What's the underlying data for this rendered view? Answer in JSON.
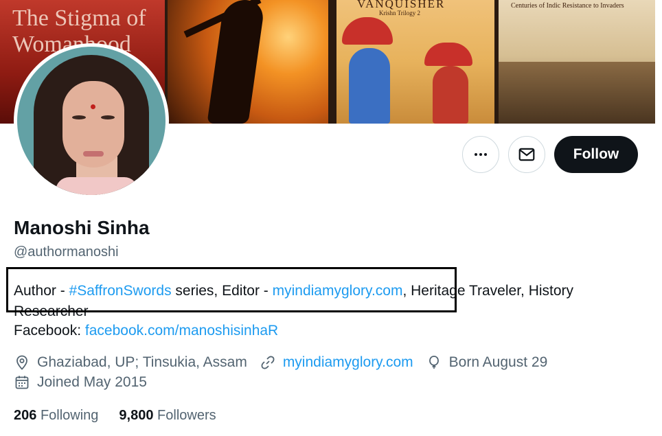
{
  "banner": {
    "book1_title": "The Stigma of Womanhood",
    "book3_title": "VANQUISHER",
    "book3_subtitle": "Krishn Trilogy 2",
    "book4_subtitle": "Centuries of Indic Resistance to Invaders"
  },
  "actions": {
    "more_icon": "more-horizontal-icon",
    "message_icon": "mail-icon",
    "follow_label": "Follow"
  },
  "profile": {
    "name": "Manoshi Sinha",
    "handle": "@authormanoshi",
    "bio": {
      "part1": "Author - ",
      "hashtag": "#SaffronSwords",
      "part2": " series, Editor - ",
      "site": "myindiamyglory.com",
      "part3": ", Heritage Traveler, History Researcher"
    },
    "facebook": {
      "label": "Facebook: ",
      "url": "facebook.com/manoshisinhaR"
    },
    "location": "Ghaziabad, UP; Tinsukia, Assam",
    "website": "myindiamyglory.com",
    "birthday": "Born August 29",
    "joined": "Joined May 2015"
  },
  "stats": {
    "following_count": "206",
    "following_label": "Following",
    "followers_count": "9,800",
    "followers_label": "Followers"
  },
  "colors": {
    "link": "#1d9bf0",
    "text": "#0f1419",
    "secondary": "#536471",
    "follow_bg": "#0f1419"
  }
}
